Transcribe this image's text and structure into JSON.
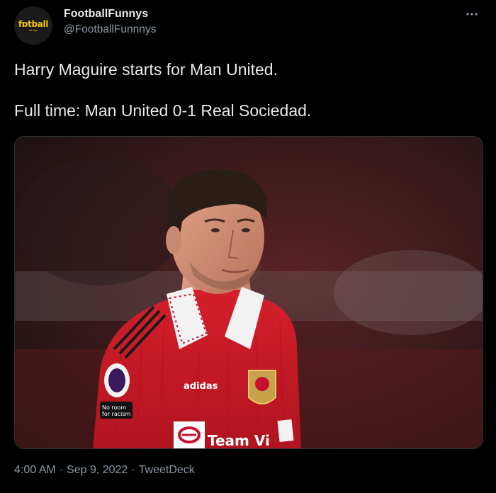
{
  "author": {
    "avatar_text": "fɒtball",
    "avatar_subtext": "funnys",
    "display_name": "FootballFunnys",
    "handle": "@FootballFunnnys"
  },
  "more_icon": "more-horizontal-icon",
  "tweet": {
    "line1": "Harry Maguire starts for Man United.",
    "line2": "Full time: Man United 0-1 Real Sociedad."
  },
  "media": {
    "kit_text_adidas": "adidas",
    "sponsor_text": "Team Vi",
    "badge_text": "No room for racism"
  },
  "meta": {
    "time": "4:00 AM",
    "separator": "·",
    "date": "Sep 9, 2022",
    "source": "TweetDeck"
  },
  "colors": {
    "background": "#000000",
    "text": "#e7e9ea",
    "secondary": "#8b98a5",
    "kit_red": "#c8102e",
    "avatar_accent": "#f2c200"
  }
}
